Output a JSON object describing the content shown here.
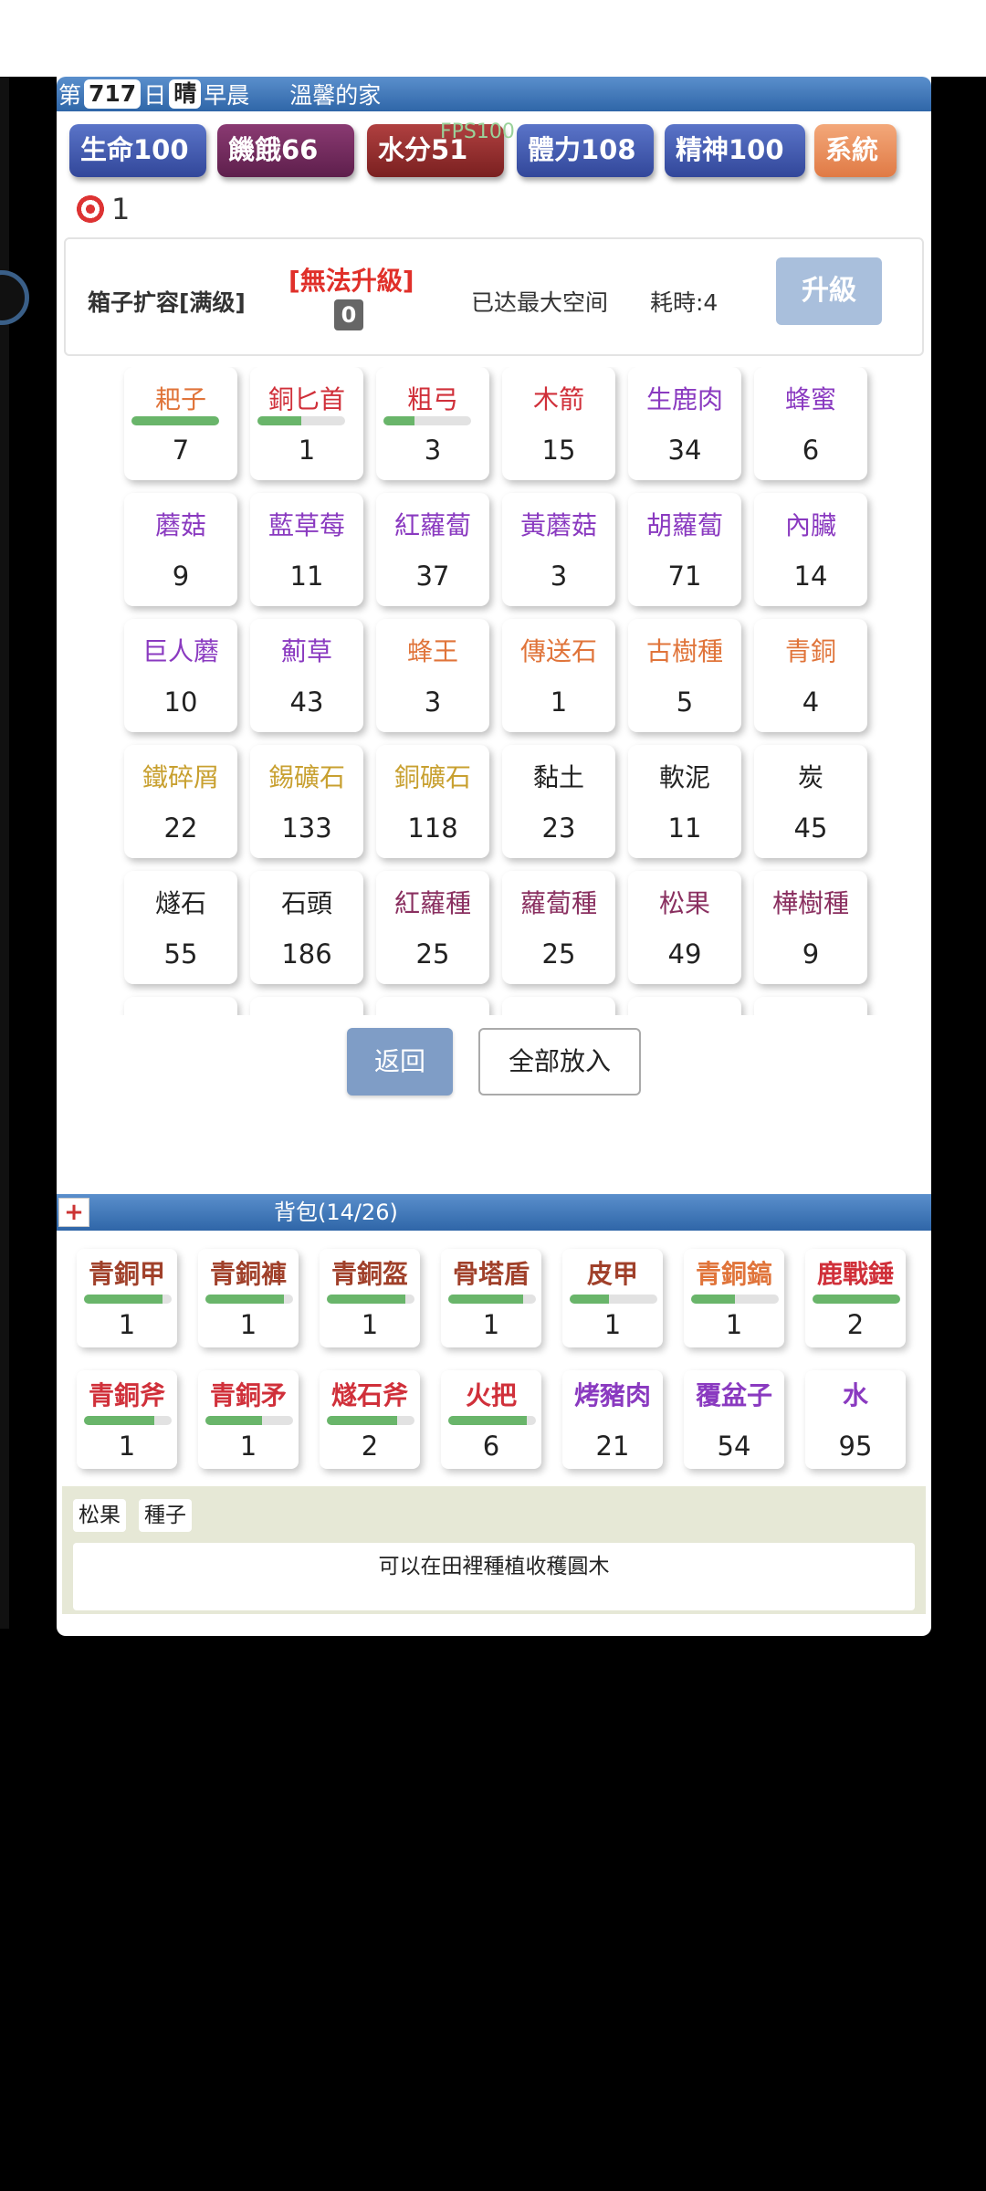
{
  "status": {
    "day_prefix": "第",
    "day": "717",
    "day_suffix": "日",
    "weather": "晴",
    "time": "早晨",
    "location": "溫馨的家"
  },
  "stats": {
    "life": "生命100",
    "hunger": "饑餓66",
    "water": "水分51",
    "stamina": "體力108",
    "mind": "精神100",
    "system": "系統"
  },
  "fps": "FPS100",
  "target_count": "1",
  "upgrade": {
    "name": "箱子扩容[满级]",
    "status": "[無法升級]",
    "level": "0",
    "max_space": "已达最大空间",
    "time": "耗時:4",
    "button": "升級"
  },
  "storage": [
    {
      "name": "耙子",
      "count": "7",
      "color": "#e0743a",
      "durability": 1.0
    },
    {
      "name": "銅匕首",
      "count": "1",
      "color": "#d0303a",
      "durability": 0.5
    },
    {
      "name": "粗弓",
      "count": "3",
      "color": "#d0303a",
      "durability": 0.35
    },
    {
      "name": "木箭",
      "count": "15",
      "color": "#d0303a"
    },
    {
      "name": "生鹿肉",
      "count": "34",
      "color": "#8a3ac0"
    },
    {
      "name": "蜂蜜",
      "count": "6",
      "color": "#8a3ac0"
    },
    {
      "name": "蘑菇",
      "count": "9",
      "color": "#8a3ac0"
    },
    {
      "name": "藍草莓",
      "count": "11",
      "color": "#8a3ac0"
    },
    {
      "name": "紅蘿蔔",
      "count": "37",
      "color": "#8a3ac0"
    },
    {
      "name": "黃蘑菇",
      "count": "3",
      "color": "#8a3ac0"
    },
    {
      "name": "胡蘿蔔",
      "count": "71",
      "color": "#8a3ac0"
    },
    {
      "name": "內臟",
      "count": "14",
      "color": "#8a3ac0"
    },
    {
      "name": "巨人蘑",
      "count": "10",
      "color": "#8a3ac0"
    },
    {
      "name": "薊草",
      "count": "43",
      "color": "#8a3ac0"
    },
    {
      "name": "蜂王",
      "count": "3",
      "color": "#e0743a"
    },
    {
      "name": "傳送石",
      "count": "1",
      "color": "#e0743a"
    },
    {
      "name": "古樹種",
      "count": "5",
      "color": "#e0743a"
    },
    {
      "name": "青銅",
      "count": "4",
      "color": "#e0743a"
    },
    {
      "name": "鐵碎屑",
      "count": "22",
      "color": "#c8a030"
    },
    {
      "name": "錫礦石",
      "count": "133",
      "color": "#c8a030"
    },
    {
      "name": "銅礦石",
      "count": "118",
      "color": "#c8a030"
    },
    {
      "name": "黏土",
      "count": "23",
      "color": "#222222"
    },
    {
      "name": "軟泥",
      "count": "11",
      "color": "#222222"
    },
    {
      "name": "炭",
      "count": "45",
      "color": "#222222"
    },
    {
      "name": "燧石",
      "count": "55",
      "color": "#222222"
    },
    {
      "name": "石頭",
      "count": "186",
      "color": "#222222"
    },
    {
      "name": "紅蘿種",
      "count": "25",
      "color": "#8a3060"
    },
    {
      "name": "蘿蔔種",
      "count": "25",
      "color": "#8a3060"
    },
    {
      "name": "松果",
      "count": "49",
      "color": "#8a3060"
    },
    {
      "name": "樺樹種",
      "count": "9",
      "color": "#8a3060"
    }
  ],
  "buttons": {
    "back": "返回",
    "put_all": "全部放入"
  },
  "backpack": {
    "plus": "+",
    "title": "背包(14/26)",
    "items": [
      {
        "name": "青銅甲",
        "count": "1",
        "color": "#a0402a",
        "durability": 0.9
      },
      {
        "name": "青銅褲",
        "count": "1",
        "color": "#a0402a",
        "durability": 0.9
      },
      {
        "name": "青銅盔",
        "count": "1",
        "color": "#a0402a",
        "durability": 0.9
      },
      {
        "name": "骨塔盾",
        "count": "1",
        "color": "#a0402a",
        "durability": 0.85
      },
      {
        "name": "皮甲",
        "count": "1",
        "color": "#a0402a",
        "durability": 0.45
      },
      {
        "name": "青銅鎬",
        "count": "1",
        "color": "#e0743a",
        "durability": 0.5
      },
      {
        "name": "鹿戰錘",
        "count": "2",
        "color": "#d0303a",
        "durability": 1.0
      },
      {
        "name": "青銅斧",
        "count": "1",
        "color": "#d0303a",
        "durability": 0.8
      },
      {
        "name": "青銅矛",
        "count": "1",
        "color": "#d0303a",
        "durability": 0.65
      },
      {
        "name": "燧石斧",
        "count": "2",
        "color": "#d0303a",
        "durability": 0.8
      },
      {
        "name": "火把",
        "count": "6",
        "color": "#d0303a",
        "durability": 0.9
      },
      {
        "name": "烤豬肉",
        "count": "21",
        "color": "#8a3ac0"
      },
      {
        "name": "覆盆子",
        "count": "54",
        "color": "#8a3ac0"
      },
      {
        "name": "水",
        "count": "95",
        "color": "#8a3ac0"
      }
    ]
  },
  "info": {
    "tag1": "松果",
    "tag2": "種子",
    "description": "可以在田裡種植收穫圓木"
  }
}
